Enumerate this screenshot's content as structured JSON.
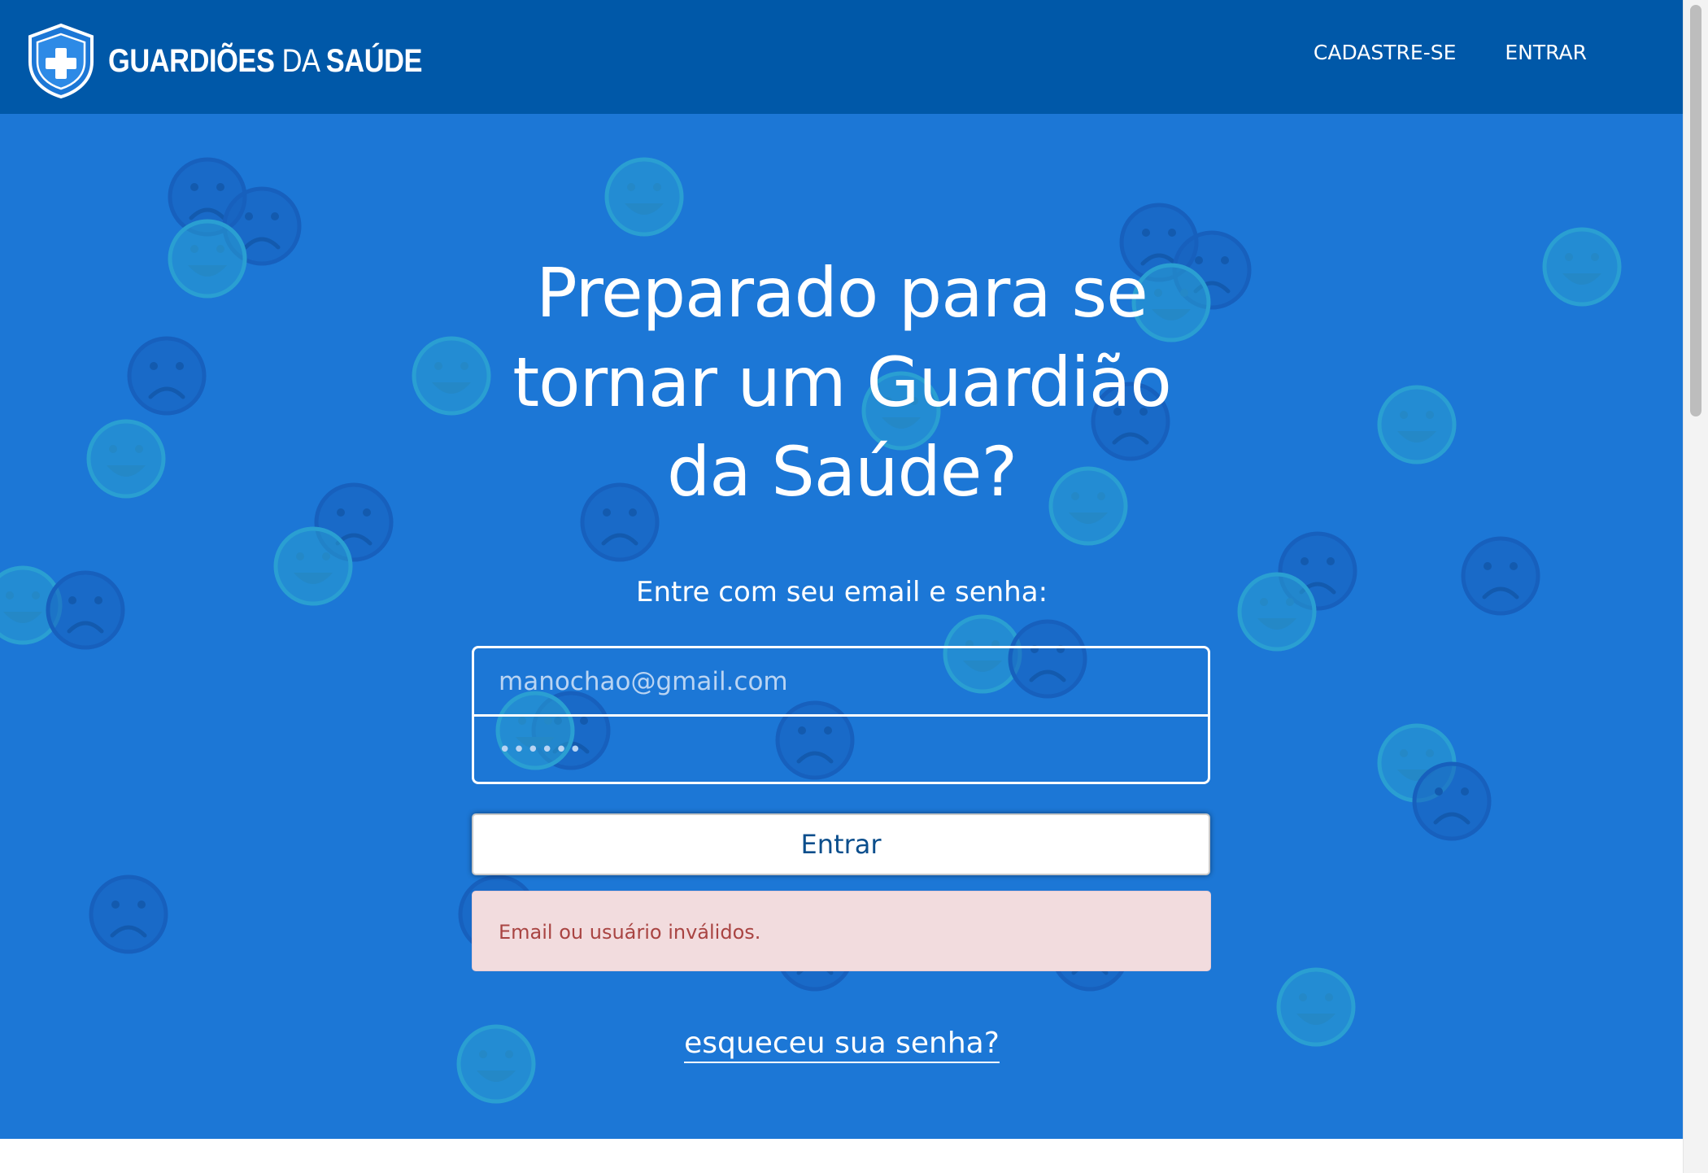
{
  "header": {
    "brand_bold": "GUARDIÕES",
    "brand_light": "DA",
    "brand_bold2": "SAÚDE",
    "nav": [
      "CADASTRE-SE",
      "ENTRAR"
    ]
  },
  "hero": {
    "title": "Preparado para se tornar um Guardião da Saúde?",
    "subtitle": "Entre com seu email e senha:",
    "form": {
      "email_value": "manochao@gmail.com",
      "password_value": "••••••",
      "submit_label": "Entrar"
    },
    "error_message": "Email ou usuário inválidos.",
    "forgot_link": "esqueceu sua senha?"
  },
  "icons": {
    "brand": "shield-plus-icon",
    "background": "smiley-face-pattern"
  },
  "colors": {
    "navbar": "#0058a8",
    "hero": "#1c77d6",
    "error_bg": "#f2dcde",
    "error_text": "#a94442",
    "button_text": "#0b4e8c"
  }
}
